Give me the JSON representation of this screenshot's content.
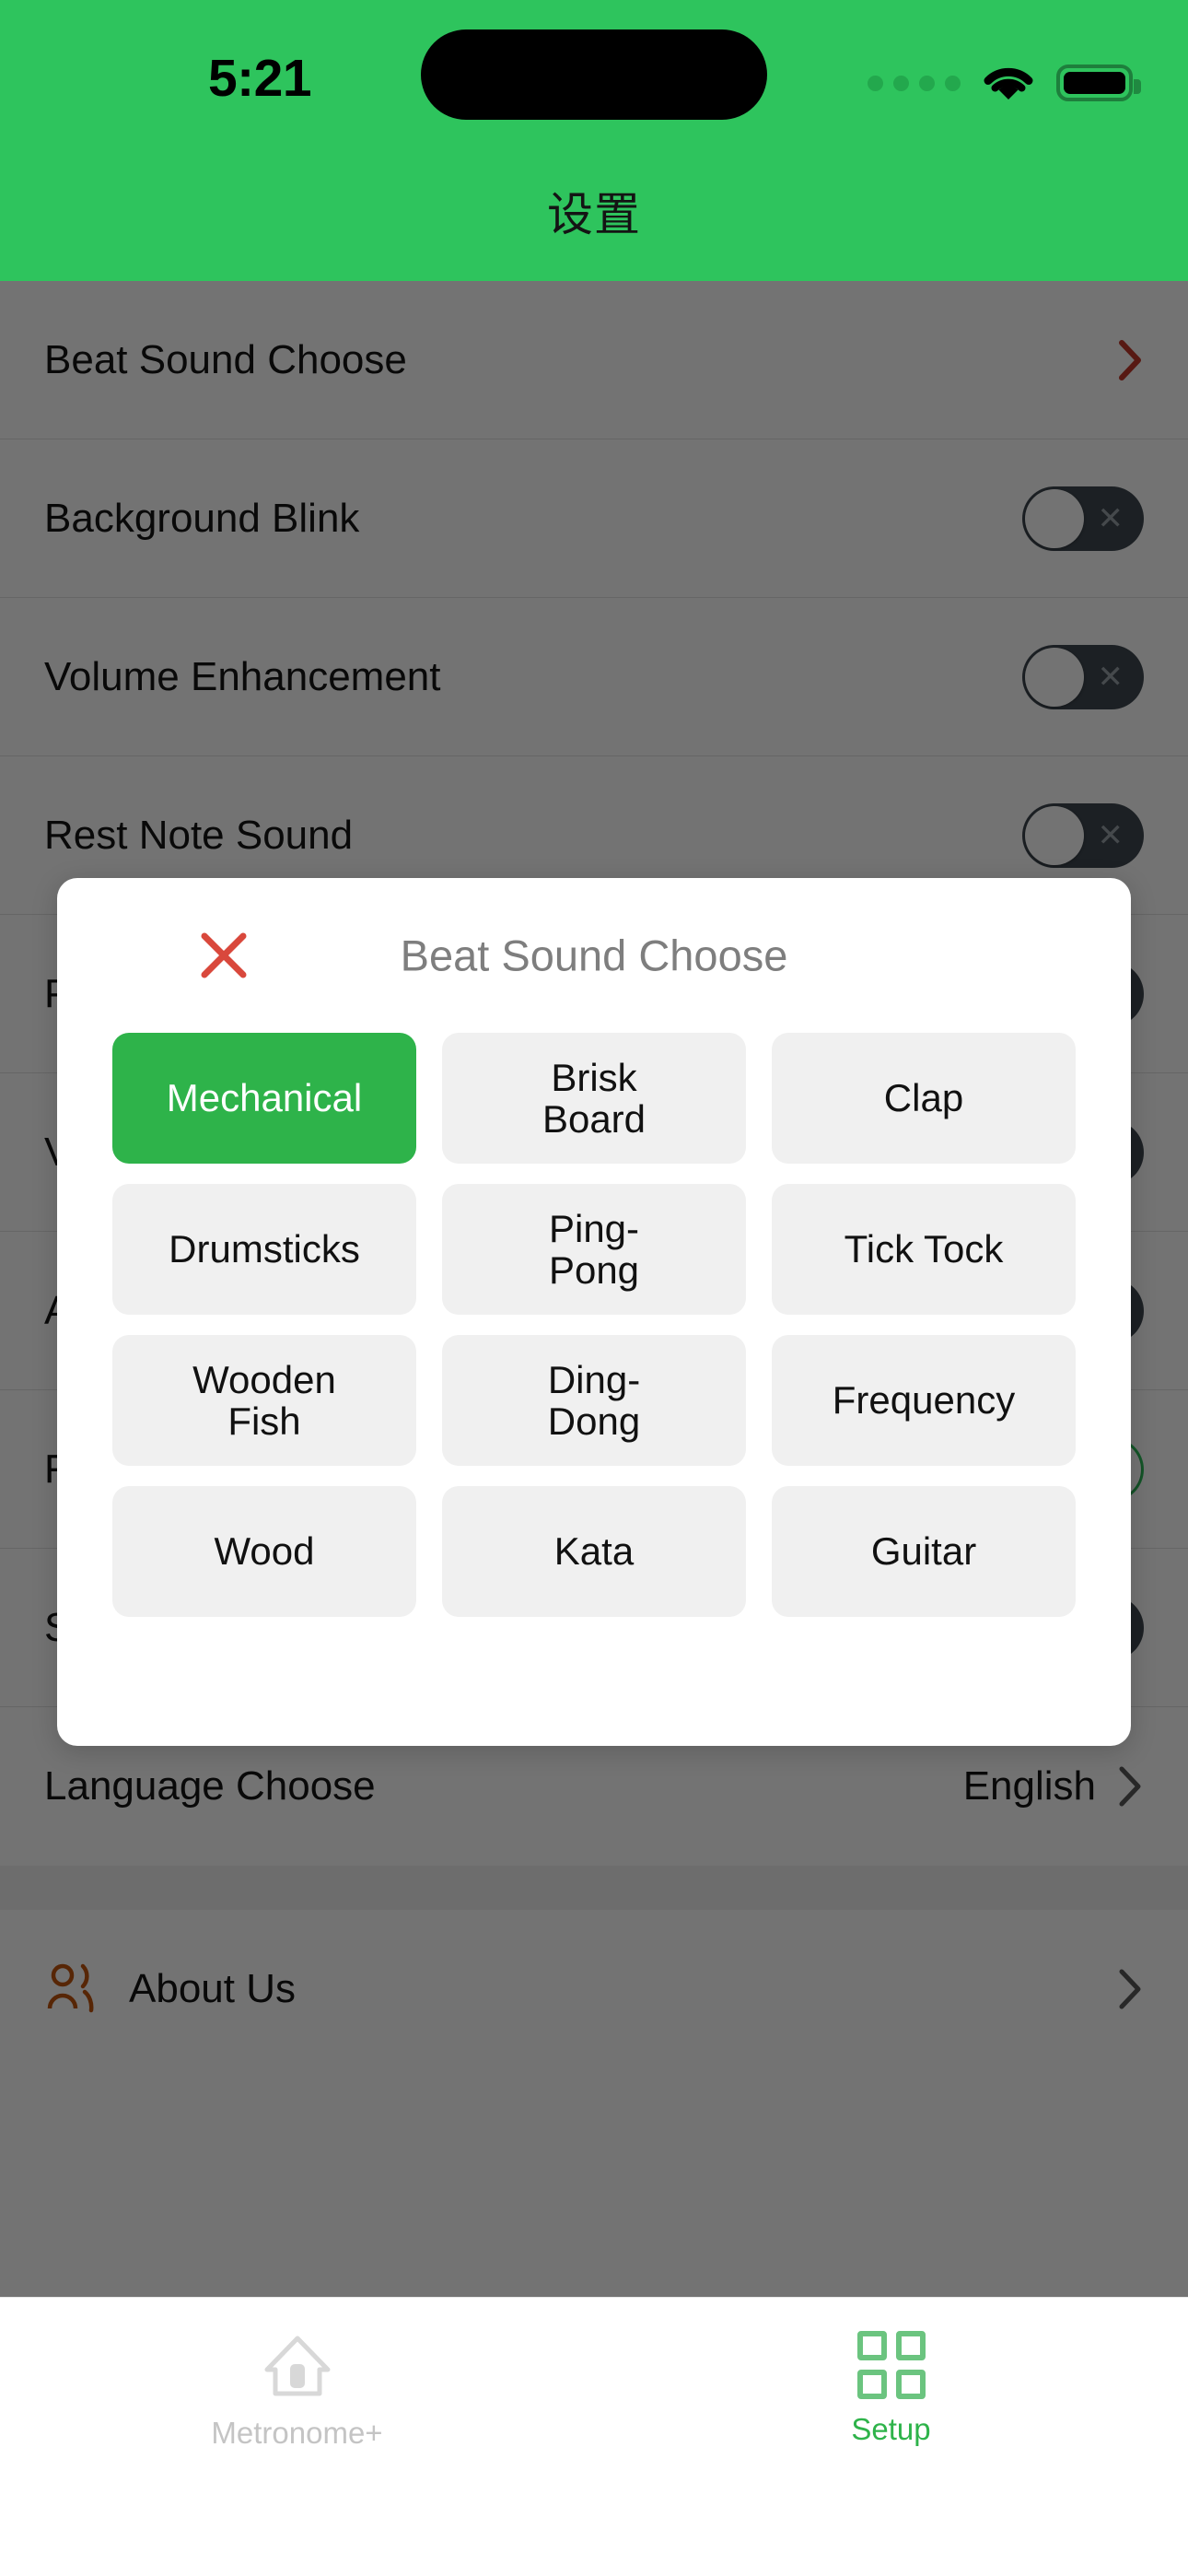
{
  "status_bar": {
    "time": "5:21",
    "signal_icon": "cellular-dots-icon",
    "wifi_icon": "wifi-icon",
    "battery_icon": "battery-full-icon"
  },
  "header": {
    "title": "设置"
  },
  "settings": {
    "group1": [
      {
        "label": "Beat Sound Choose",
        "control": "chevron",
        "accent": "#C0392B"
      },
      {
        "label": "Background Blink",
        "control": "toggle",
        "on": false
      },
      {
        "label": "Volume Enhancement",
        "control": "toggle",
        "on": false
      },
      {
        "label": "Rest Note Sound",
        "control": "toggle",
        "on": false
      },
      {
        "label": "Preparation Beats",
        "control": "toggle",
        "on": false
      },
      {
        "label": "Vibration Feedback",
        "control": "toggle",
        "on": false
      },
      {
        "label": "Auto Lock Screen",
        "control": "toggle",
        "on": false
      },
      {
        "label": "Flash Light",
        "control": "toggle",
        "on": true
      },
      {
        "label": "Screen Always On",
        "control": "toggle",
        "on": false
      },
      {
        "label": "Language Choose",
        "control": "value-chevron",
        "value": "English"
      }
    ],
    "group2": [
      {
        "label": "About Us",
        "control": "chevron",
        "icon": "people-icon",
        "icon_color": "#C0560F"
      }
    ]
  },
  "modal": {
    "title": "Beat Sound Choose",
    "close_icon": "close-x-icon",
    "close_color": "#D9483C",
    "selected": "Mechanical",
    "selected_color": "#2EB34A",
    "options": [
      "Mechanical",
      "Brisk\nBoard",
      "Clap",
      "Drumsticks",
      "Ping-\nPong",
      "Tick Tock",
      "Wooden\nFish",
      "Ding-\nDong",
      "Frequency",
      "Wood",
      "Kata",
      "Guitar"
    ]
  },
  "tabbar": {
    "tabs": [
      {
        "label": "Metronome+",
        "icon": "home-icon",
        "active": false
      },
      {
        "label": "Setup",
        "icon": "grid-icon",
        "active": true
      }
    ]
  },
  "colors": {
    "brand_green": "#2EC45D",
    "selected_green": "#2EB34A",
    "accent_red": "#C0392B",
    "scrim": "rgba(0,0,0,0.55)"
  }
}
